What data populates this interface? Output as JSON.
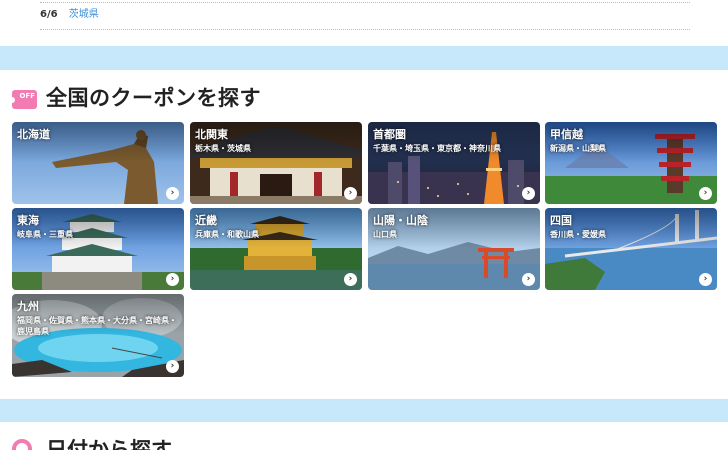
{
  "top_row": {
    "date": "6/6",
    "pref": "茨城県"
  },
  "coupon_section": {
    "icon_text": "OFF",
    "title": "全国のクーポンを探す"
  },
  "regions": [
    {
      "name": "北海道",
      "sub": "",
      "arrow": "›"
    },
    {
      "name": "北関東",
      "sub": "栃木県・茨城県",
      "arrow": "›"
    },
    {
      "name": "首都圏",
      "sub": "千葉県・埼玉県・東京都・神奈川県",
      "arrow": "›"
    },
    {
      "name": "甲信越",
      "sub": "新潟県・山梨県",
      "arrow": "›"
    },
    {
      "name": "東海",
      "sub": "岐阜県・三重県",
      "arrow": "›"
    },
    {
      "name": "近畿",
      "sub": "兵庫県・和歌山県",
      "arrow": "›"
    },
    {
      "name": "山陽・山陰",
      "sub": "山口県",
      "arrow": "›"
    },
    {
      "name": "四国",
      "sub": "香川県・愛媛県",
      "arrow": "›"
    },
    {
      "name": "九州",
      "sub": "福岡県・佐賀県・熊本県・大分県・宮崎県・鹿児島県",
      "arrow": "›"
    }
  ],
  "date_section": {
    "title": "日付から探す"
  }
}
